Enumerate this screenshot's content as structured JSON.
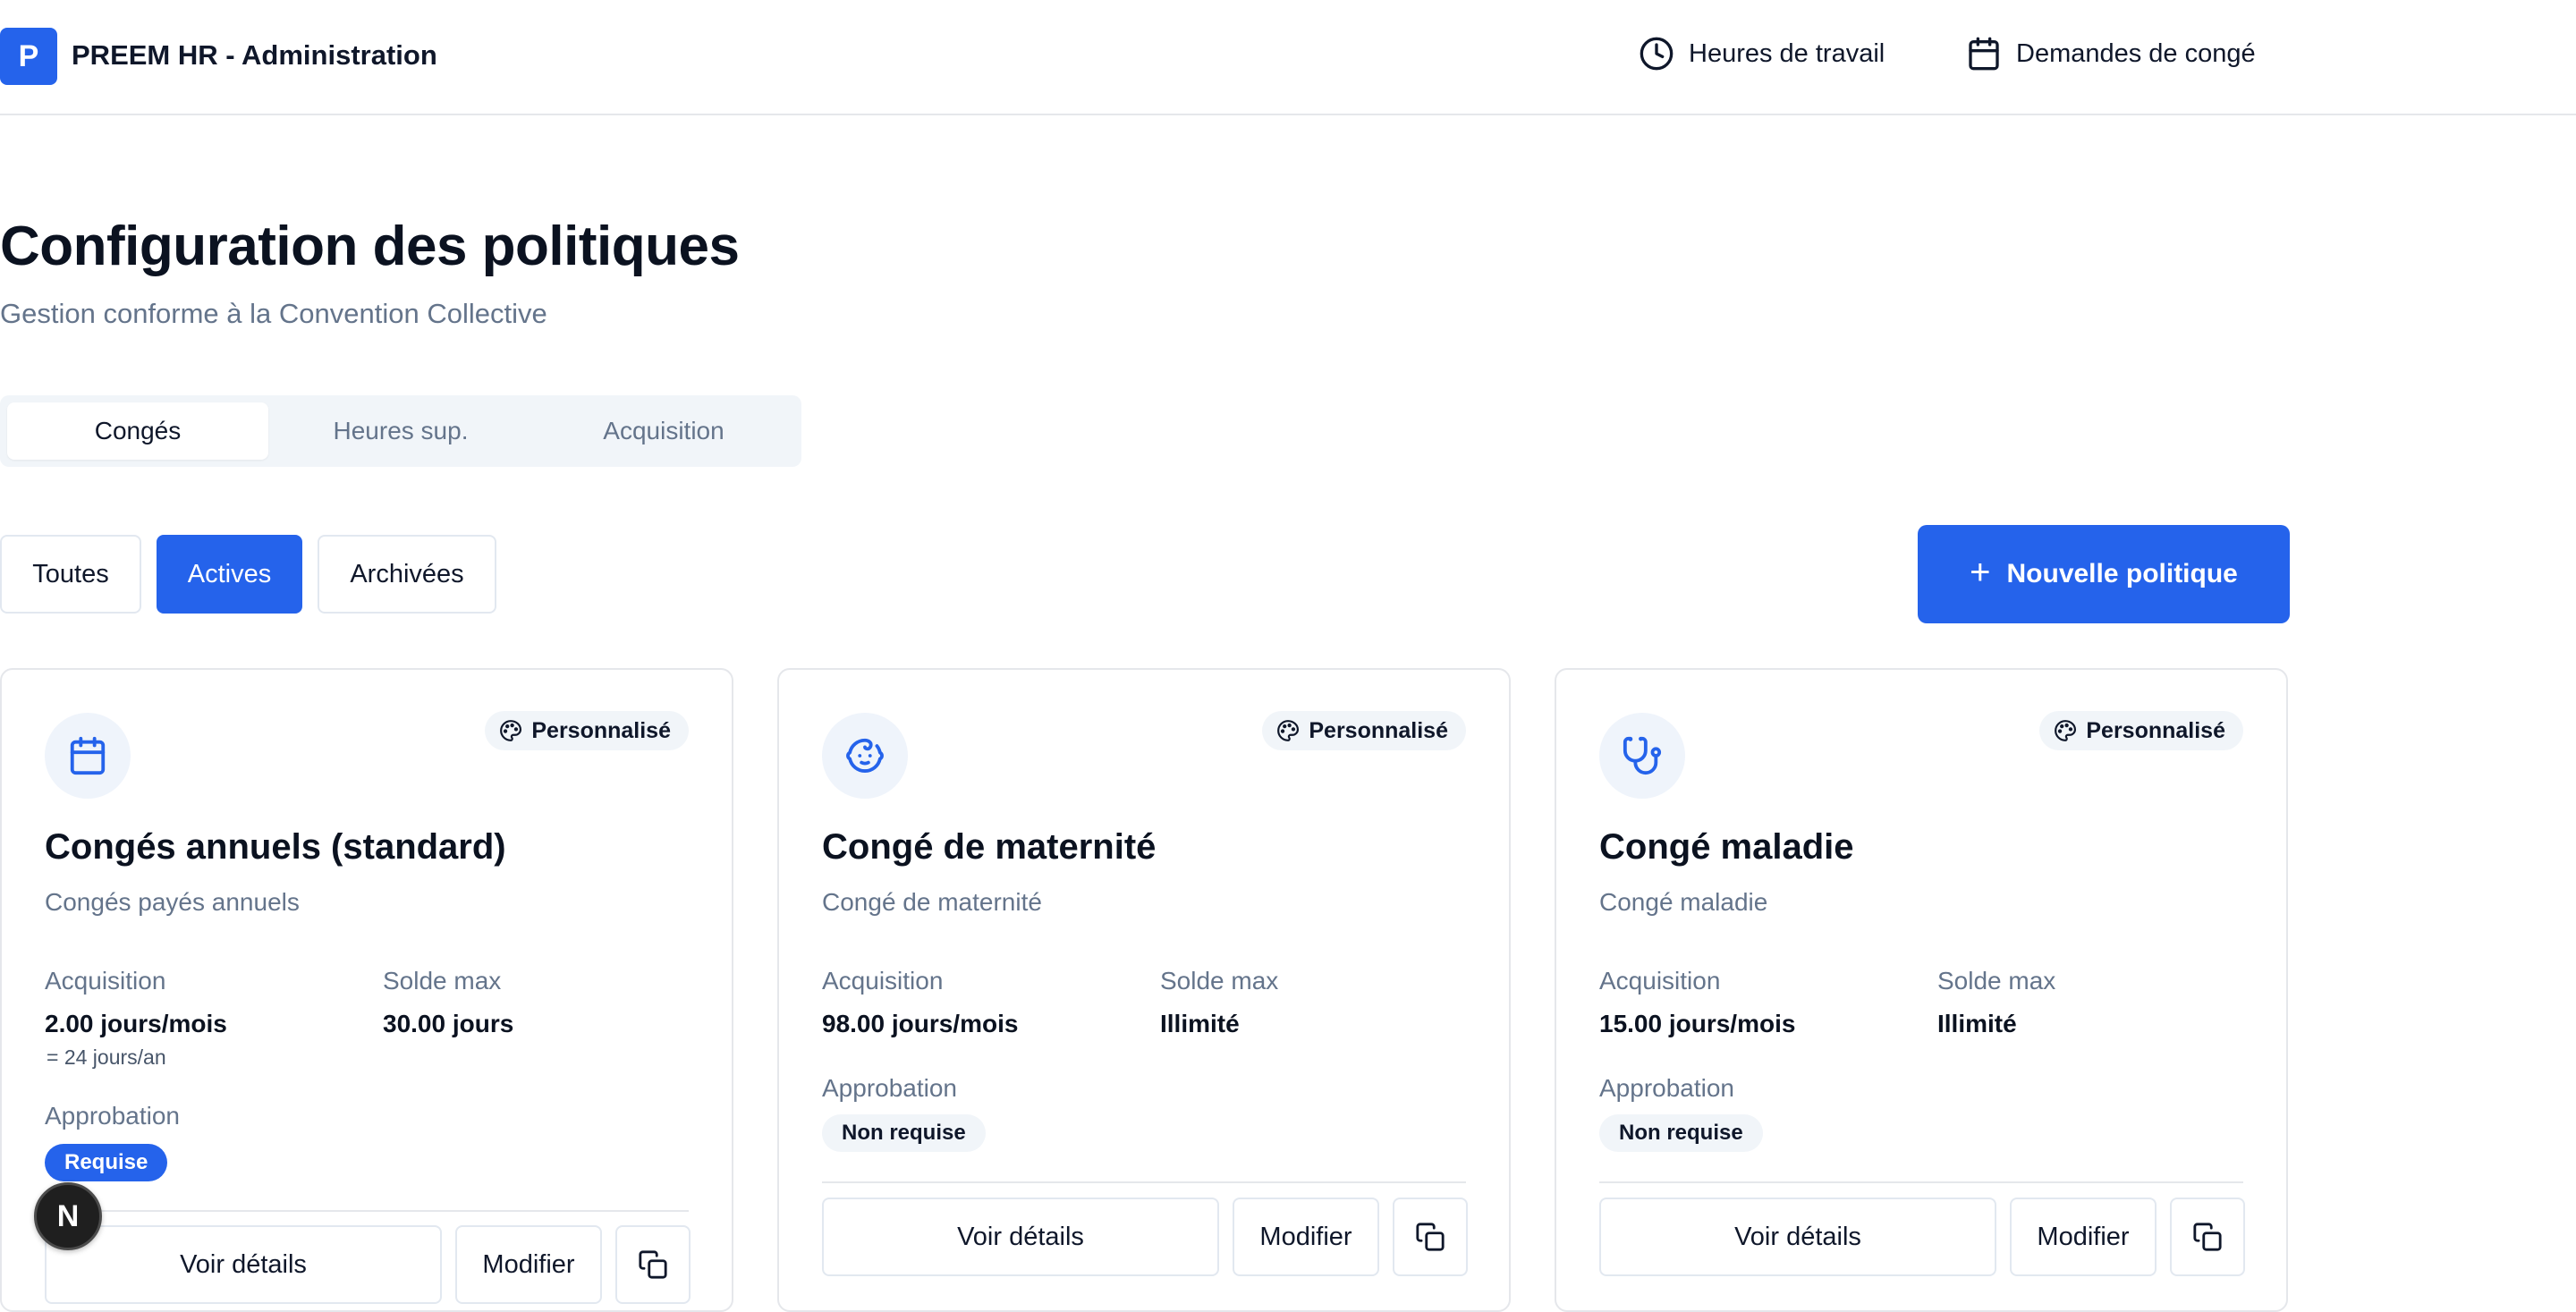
{
  "header": {
    "logo_letter": "P",
    "app_title": "PREEM HR - Administration",
    "nav": [
      {
        "label": "Heures de travail",
        "icon": "clock-icon"
      },
      {
        "label": "Demandes de congé",
        "icon": "calendar-icon"
      }
    ]
  },
  "page": {
    "title": "Configuration des politiques",
    "subtitle": "Gestion conforme à la Convention Collective"
  },
  "tabs": [
    {
      "label": "Congés",
      "active": true
    },
    {
      "label": "Heures sup.",
      "active": false
    },
    {
      "label": "Acquisition",
      "active": false
    }
  ],
  "filters": [
    {
      "label": "Toutes",
      "active": false
    },
    {
      "label": "Actives",
      "active": true
    },
    {
      "label": "Archivées",
      "active": false
    }
  ],
  "new_policy_button": {
    "label": "Nouvelle politique",
    "icon": "plus-icon"
  },
  "labels": {
    "acquisition": "Acquisition",
    "max_balance": "Solde max",
    "approval": "Approbation",
    "view_details": "Voir détails",
    "edit": "Modifier"
  },
  "cards": [
    {
      "icon": "calendar-icon",
      "badge": "Personnalisé",
      "title": "Congés annuels (standard)",
      "description": "Congés payés annuels",
      "acquisition": "2.00 jours/mois",
      "acquisition_note": "= 24 jours/an",
      "max_balance": "30.00 jours",
      "approval": "Requise"
    },
    {
      "icon": "baby-icon",
      "badge": "Personnalisé",
      "title": "Congé de maternité",
      "description": "Congé de maternité",
      "acquisition": "98.00 jours/mois",
      "max_balance": "Illimité",
      "approval": "Non requise"
    },
    {
      "icon": "stethoscope-icon",
      "badge": "Personnalisé",
      "title": "Congé maladie",
      "description": "Congé maladie",
      "acquisition": "15.00 jours/mois",
      "max_balance": "Illimité",
      "approval": "Non requise"
    }
  ],
  "floating_button": {
    "label": "N"
  },
  "colors": {
    "primary": "#2563eb",
    "muted_text": "#64748b",
    "border": "#e5e7eb"
  }
}
